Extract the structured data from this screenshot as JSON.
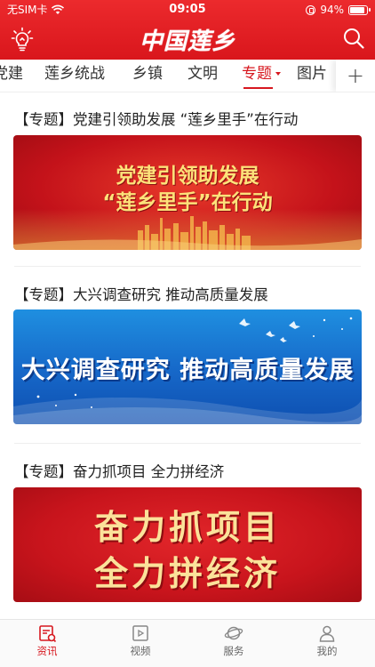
{
  "status_bar": {
    "carrier": "无SIM卡",
    "time": "09:05",
    "battery_percent": "94%",
    "battery_level": 0.94
  },
  "header": {
    "logo": "中国莲乡",
    "left_icon": "lightbulb-icon",
    "right_icon": "search-icon",
    "accent_color": "#d7181f"
  },
  "tabs": [
    {
      "label": "党建",
      "active": false
    },
    {
      "label": "莲乡统战",
      "active": false
    },
    {
      "label": "乡镇",
      "active": false
    },
    {
      "label": "文明",
      "active": false
    },
    {
      "label": "专题",
      "active": true
    },
    {
      "label": "图片",
      "active": false
    }
  ],
  "tabs_more_icon": "plus-icon",
  "feed": [
    {
      "title": "【专题】党建引领助发展 “莲乡里手”在行动",
      "banner_line1": "党建引领助发展",
      "banner_line2": "“莲乡里手”在行动",
      "banner_color": "#c4121a"
    },
    {
      "title": "【专题】大兴调查研究 推动高质量发展",
      "banner_line1": "大兴调查研究  推动高质量发展",
      "banner_color": "#1667c8"
    },
    {
      "title": "【专题】奋力抓项目 全力拼经济",
      "banner_line1": "奋力抓项目",
      "banner_line2": "全力拼经济",
      "banner_color": "#c8141c"
    }
  ],
  "bottom_nav": [
    {
      "label": "资讯",
      "icon": "news-icon",
      "active": true
    },
    {
      "label": "视频",
      "icon": "video-icon",
      "active": false
    },
    {
      "label": "服务",
      "icon": "planet-icon",
      "active": false
    },
    {
      "label": "我的",
      "icon": "profile-icon",
      "active": false
    }
  ]
}
